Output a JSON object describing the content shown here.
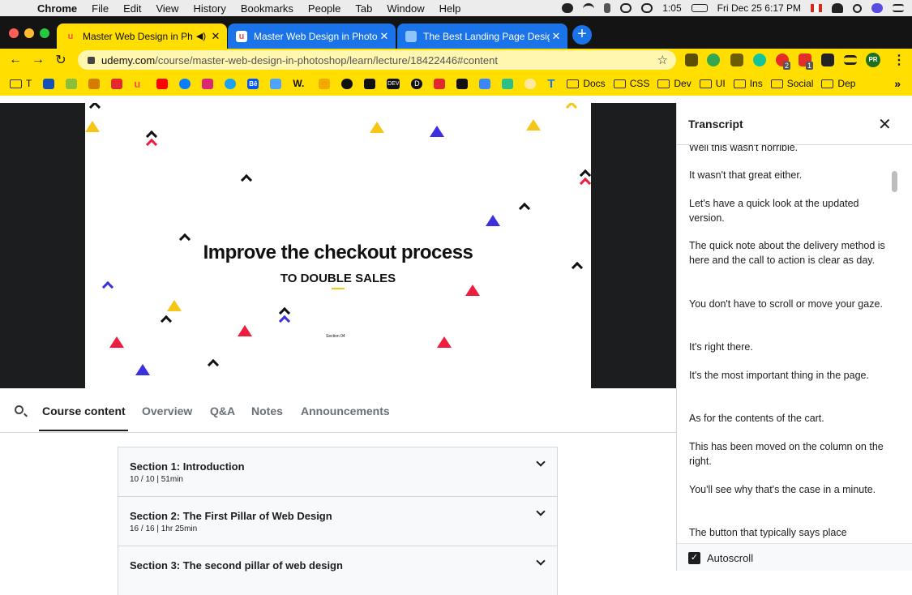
{
  "menubar": {
    "apple": "",
    "items": [
      "Chrome",
      "File",
      "Edit",
      "View",
      "History",
      "Bookmarks",
      "People",
      "Tab",
      "Window",
      "Help"
    ],
    "time_short": "1:05",
    "datetime": "Fri Dec 25  6:17 PM"
  },
  "tabs": [
    {
      "title": "Master Web Design in Phot",
      "active": true,
      "audio": true
    },
    {
      "title": "Master Web Design in Photosh",
      "active": false
    },
    {
      "title": "The Best Landing Page Design",
      "active": false
    }
  ],
  "newtab": "+",
  "address": {
    "host": "udemy.com",
    "path": "/course/master-web-design-in-photoshop/learn/lecture/18422446#content"
  },
  "extension_badges": [
    "2",
    "1"
  ],
  "profile_initials": "PR",
  "bookmarks": {
    "first_label": "T",
    "be_label": "Bē",
    "w_label": "W.",
    "dev_label": "DEV",
    "d_label": "D",
    "t_label": "T",
    "folders": [
      "Docs",
      "CSS",
      "Dev",
      "UI",
      "Ins",
      "Social",
      "Dep"
    ],
    "more": "»"
  },
  "slide": {
    "title": "Improve the checkout process",
    "subtitle": "TO DOUBLE SALES",
    "section": "Section 04"
  },
  "course_tabs": [
    "Course content",
    "Overview",
    "Q&A",
    "Notes",
    "Announcements"
  ],
  "sections": [
    {
      "title": "Section 1: Introduction",
      "meta": "10 / 10 | 51min"
    },
    {
      "title": "Section 2: The First Pillar of Web Design",
      "meta": "16 / 16 | 1hr 25min"
    },
    {
      "title": "Section 3: The second pillar of web design",
      "meta": ""
    }
  ],
  "transcript": {
    "title": "Transcript",
    "close": "✕",
    "cues": [
      "Well this wasn't horrible.",
      "It wasn't that great either.",
      "Let's have a quick look at the updated version.",
      "The quick note about the delivery method is here and the call to action is clear as day.",
      "You don't have to scroll or move your gaze.",
      "It's right there.",
      "It's the most important thing in the page.",
      "As for the contents of the cart.",
      "This has been moved on the column on the right.",
      "You'll see why that's the case in a minute.",
      "The button that typically says place"
    ],
    "autoscroll_label": "Autoscroll",
    "autoscroll_checked": true
  },
  "colors": {
    "toolbar": "#ffde00",
    "tab_active": "#ffde00",
    "tab_inactive": "#1a73e8",
    "tab_bar": "#141414",
    "accent_red": "#ee1d3d",
    "accent_blue": "#3b2fe0",
    "accent_yellow": "#f5c518"
  }
}
